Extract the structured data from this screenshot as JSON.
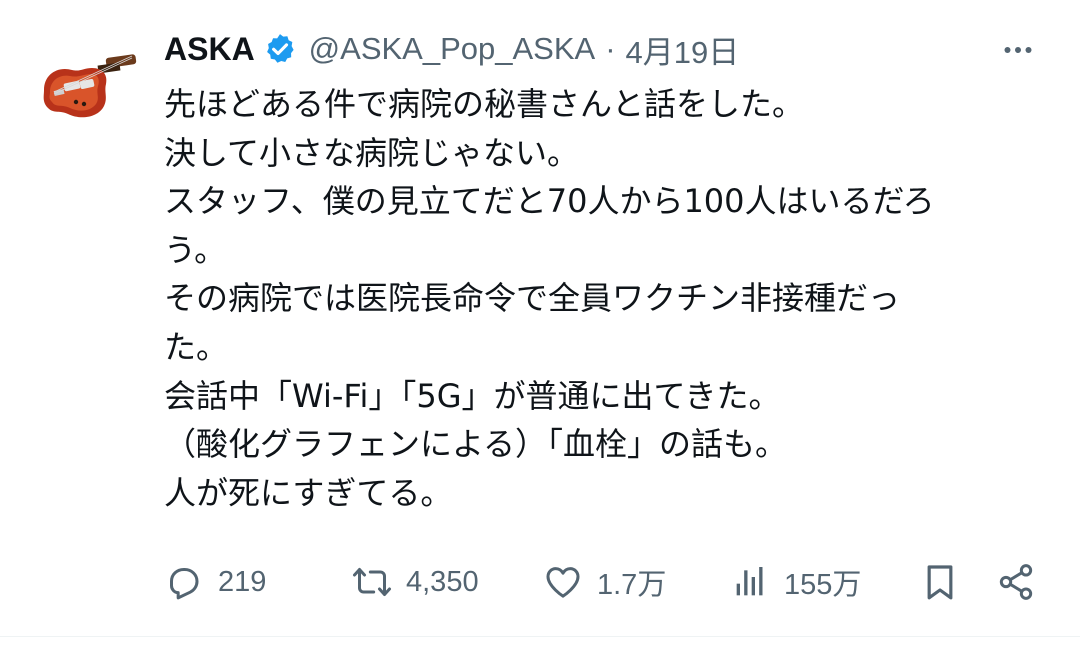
{
  "tweet": {
    "author_name": "ASKA",
    "handle": "@ASKA_Pop_ASKA",
    "separator": "·",
    "date": "4月19日",
    "verified_color": "#1d9bf0",
    "avatar_icon": "violin-bass-guitar-icon",
    "lines": [
      "先ほどある件で病院の秘書さんと話をした。",
      "決して小さな病院じゃない。",
      "スタッフ、僕の見立てだと70人から100人はいるだろ",
      "う。",
      "その病院では医院長命令で全員ワクチン非接種だっ",
      "た。",
      "会話中「Wi-Fi」「5G」が普通に出てきた。",
      "（酸化グラフェンによる）「血栓」の話も。",
      "人が死にすぎてる。"
    ],
    "actions": {
      "reply_count": "219",
      "retweet_count": "4,350",
      "like_count": "1.7万",
      "view_count": "155万"
    }
  },
  "colors": {
    "text_primary": "#0f1419",
    "text_secondary": "#536471",
    "divider": "#eff3f4"
  }
}
